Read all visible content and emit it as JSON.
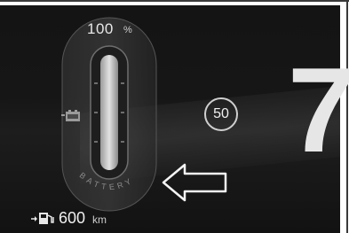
{
  "battery_gauge": {
    "percent_value": "100",
    "percent_unit": "%",
    "label": "BATTERY",
    "charge_level": 1.0
  },
  "speed_limit": {
    "value": "50"
  },
  "gear": {
    "value": "7"
  },
  "range": {
    "value": "600",
    "unit": "km"
  },
  "icons": {
    "battery_icon": "battery-icon",
    "arrow_icon": "left-arrow-icon",
    "range_icon": "fuel-range-icon"
  },
  "colors": {
    "background": "#151515",
    "text": "#f0f0f0",
    "gauge_outline": "#7a7a7a"
  }
}
